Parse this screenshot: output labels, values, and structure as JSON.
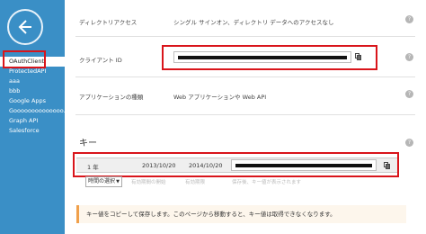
{
  "sidebar": {
    "items": [
      {
        "label": "OAuthClient",
        "active": true
      },
      {
        "label": "ProtectedAPI",
        "active": false
      },
      {
        "label": "aaa",
        "active": false
      },
      {
        "label": "bbb",
        "active": false
      },
      {
        "label": "Google Apps",
        "active": false
      },
      {
        "label": "Goooooooooooooo...",
        "active": false
      },
      {
        "label": "Graph API",
        "active": false
      },
      {
        "label": "Salesforce",
        "active": false
      }
    ]
  },
  "fields": {
    "directory_access_label": "ディレクトリアクセス",
    "directory_access_value": "シングル サインオン、ディレクトリ データへのアクセスなし",
    "client_id_label": "クライアント ID",
    "app_type_label": "アプリケーションの種類",
    "app_type_value": "Web アプリケーションや Web API"
  },
  "keys": {
    "section_title": "キー",
    "row": {
      "duration": "1 年",
      "start": "2013/10/20",
      "end": "2014/10/20"
    },
    "duration_select": "時間の選択",
    "ghost_start": "有効期間の開始",
    "ghost_end": "有効期限",
    "ghost_note": "保存後、キー値が表示されます"
  },
  "notice": "キー値をコピーして保存します。このページから移動すると、キー値は取得できなくなります。",
  "colors": {
    "sidebar": "#3a8fc6",
    "highlight": "#d9151b",
    "notice_border": "#f0a04b"
  }
}
